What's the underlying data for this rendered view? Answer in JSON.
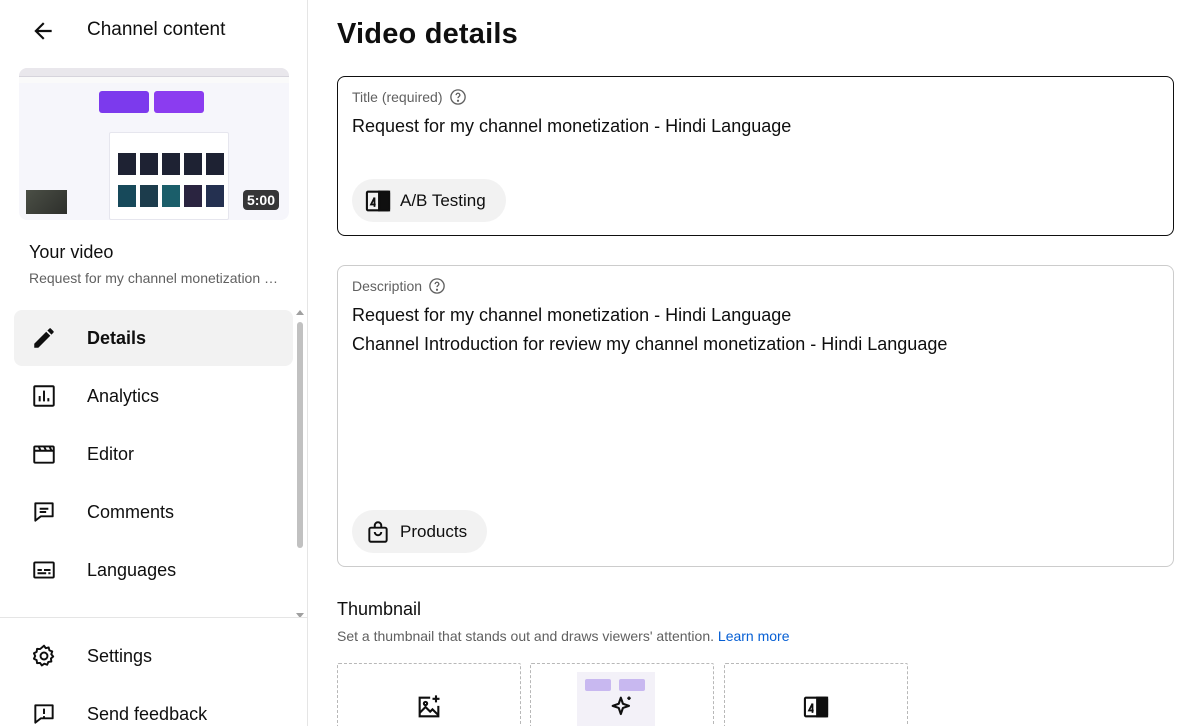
{
  "sidebar": {
    "header_title": "Channel content",
    "video": {
      "duration": "5:00",
      "section_title": "Your video",
      "video_title": "Request for my channel monetization - Hindi Language"
    },
    "nav": [
      {
        "label": "Details",
        "icon": "pencil-icon",
        "active": true
      },
      {
        "label": "Analytics",
        "icon": "analytics-icon",
        "active": false
      },
      {
        "label": "Editor",
        "icon": "clapperboard-icon",
        "active": false
      },
      {
        "label": "Comments",
        "icon": "comment-icon",
        "active": false
      },
      {
        "label": "Languages",
        "icon": "subtitles-icon",
        "active": false
      }
    ],
    "footer": [
      {
        "label": "Settings",
        "icon": "gear-icon"
      },
      {
        "label": "Send feedback",
        "icon": "feedback-icon"
      }
    ]
  },
  "main": {
    "page_title": "Video details",
    "title_field": {
      "label": "Title (required)",
      "value": "Request for my channel monetization - Hindi Language",
      "chip_label": "A/B Testing"
    },
    "description_field": {
      "label": "Description",
      "lines": [
        "Request for my channel monetization - Hindi Language",
        "Channel Introduction for review my channel monetization - Hindi Language"
      ],
      "chip_label": "Products"
    },
    "thumbnail": {
      "title": "Thumbnail",
      "description": "Set a thumbnail that stands out and draws viewers' attention.",
      "learn_more": "Learn more",
      "options": [
        {
          "icon": "upload-image-icon"
        },
        {
          "icon": "auto-generated-sparkle-icon"
        },
        {
          "icon": "ab-test-icon"
        }
      ]
    }
  },
  "colors": {
    "accent_link": "#065fd4",
    "active_nav_bg": "#f2f2f2",
    "chip_bg": "#f2f2f2",
    "thumb_purple": "#7c3aed"
  }
}
